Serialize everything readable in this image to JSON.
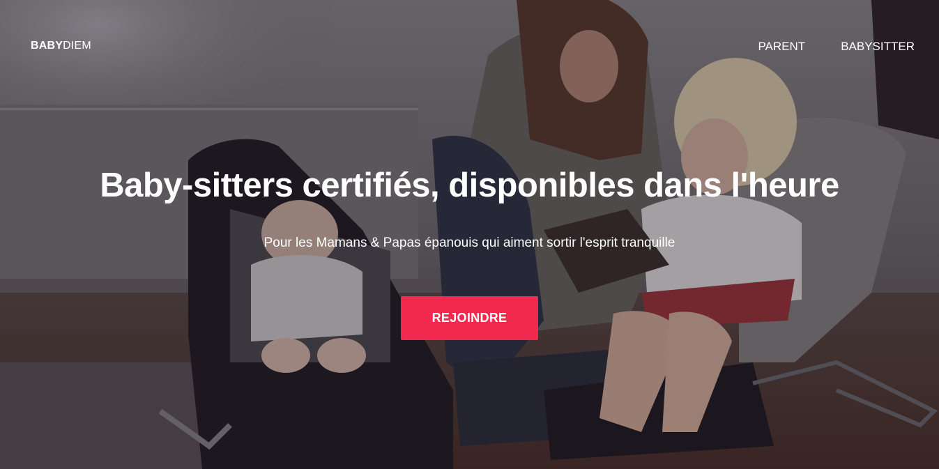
{
  "nav": {
    "logo_bold": "BABY",
    "logo_light": "DIEM",
    "links": [
      {
        "label": "PARENT"
      },
      {
        "label": "BABYSITTER"
      }
    ]
  },
  "hero": {
    "headline": "Baby-sitters certifiés, disponibles dans l'heure",
    "subtitle": "Pour les Mamans & Papas épanouis qui aiment sortir l'esprit tranquille",
    "cta_label": "REJOINDRE",
    "background_image": "mother-with-baby-and-toddler-photo"
  },
  "colors": {
    "accent": "#f2294f",
    "text": "#ffffff"
  }
}
